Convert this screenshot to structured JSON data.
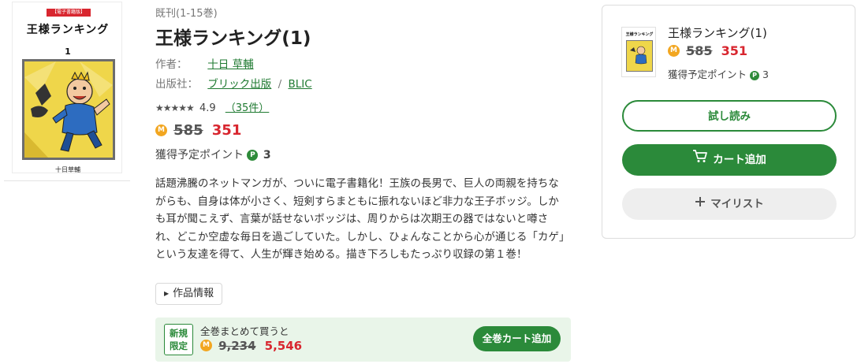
{
  "cover": {
    "badge": "【電子書籍版】",
    "title": "王様ランキング",
    "volume": "1",
    "author": "十日草輔"
  },
  "product": {
    "series": "既刊(1-15巻)",
    "title": "王様ランキング(1)",
    "author_label": "作者：",
    "author_name": "十日 草輔",
    "publisher_label": "出版社：",
    "publisher_name": "ブリック出版",
    "publisher_separator": "/",
    "imprint": "BLIC",
    "rating_stars": "★★★★★",
    "rating_value": "4.9",
    "rating_count": "（35件）",
    "coin_glyph": "M",
    "price_old": "585",
    "price_new": "351",
    "points_label": "獲得予定ポイント",
    "points_glyph": "P",
    "points_value": "3",
    "description": "話題沸騰のネットマンガが、ついに電子書籍化！王族の長男で、巨人の両親を持ちながらも、自身は体が小さく、短剣すらまともに振れないほど非力な王子ボッジ。しかも耳が聞こえず、言葉が話せないボッジは、周りからは次期王の器ではないと噂され、どこか空虚な毎日を過ごしていた。しかし、ひょんなことから心が通じる「カゲ」という友達を得て、人生が輝き始める。描き下ろしもたっぷり収録の第１巻！",
    "work_info_label": "作品情報"
  },
  "bundle": {
    "tag_line1": "新規",
    "tag_line2": "限定",
    "label": "全巻まとめて買うと",
    "price_old": "9,234",
    "price_new": "5,546",
    "button_label": "全巻カート追加"
  },
  "panel": {
    "thumb_title": "王様ランキング",
    "title": "王様ランキング(1)",
    "price_old": "585",
    "price_new": "351",
    "points_label": "獲得予定ポイント",
    "points_value": "3",
    "trial_label": "試し読み",
    "cart_label": "カート追加",
    "mylist_label": "マイリスト"
  },
  "colors": {
    "accent_green": "#2b8a3a",
    "price_red": "#d8262f",
    "coin_orange": "#f2a620",
    "bundle_bg": "#e9f5e9"
  },
  "icons": {
    "coin": "coin-icon",
    "points": "points-icon",
    "cart": "cart-icon",
    "plus": "plus-icon",
    "caret": "caret-right-icon",
    "star": "star-icon"
  }
}
